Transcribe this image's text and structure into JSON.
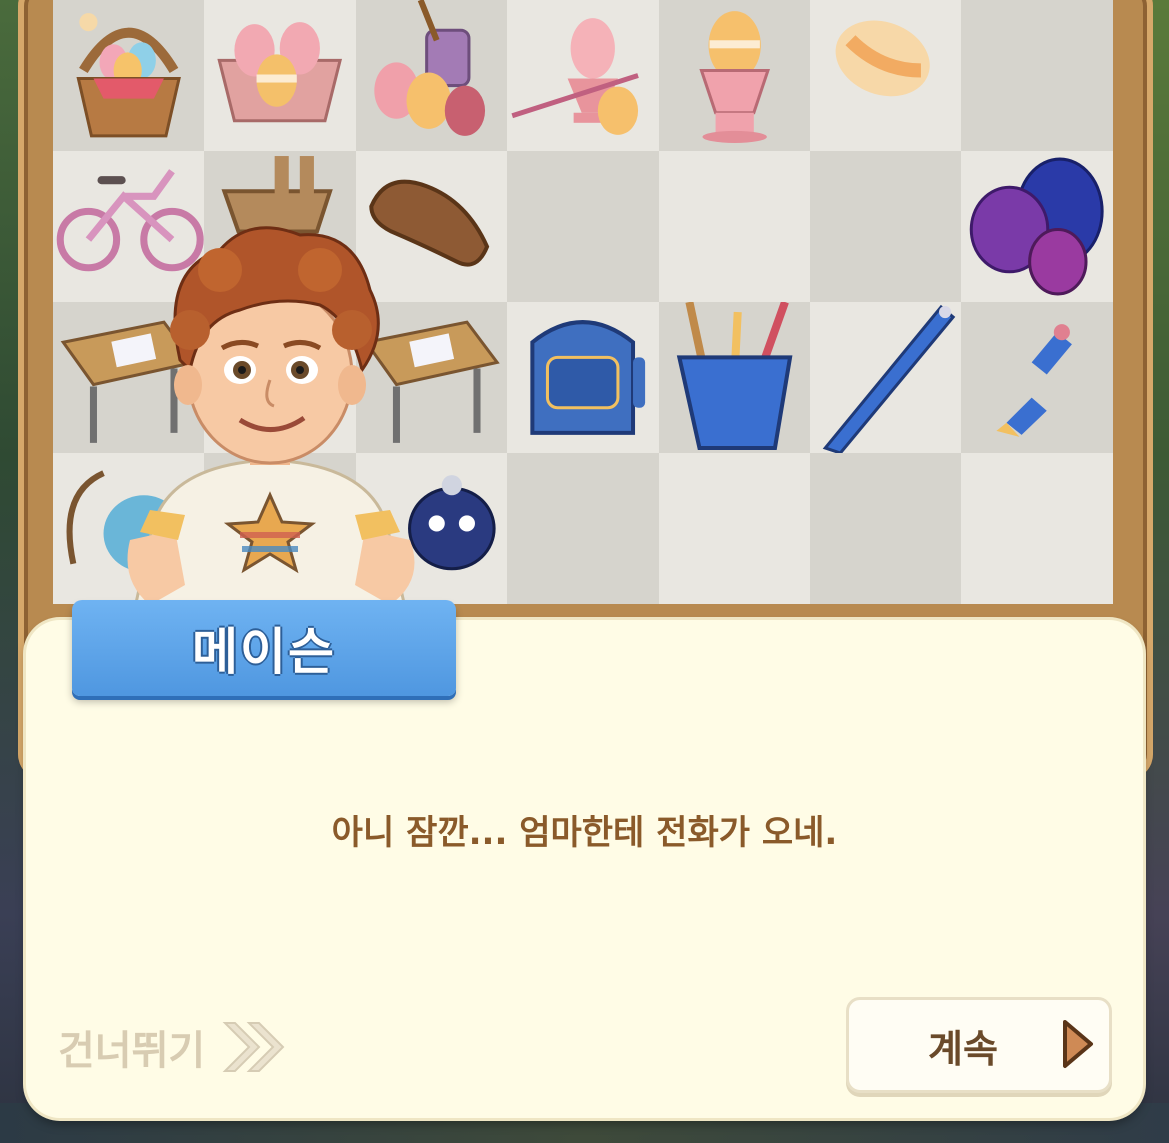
{
  "character": {
    "name": "메이슨"
  },
  "dialog": {
    "text": "아니 잠깐... 엄마한테 전화가 오네."
  },
  "controls": {
    "skip_label": "건너뛰기",
    "skip_icon": "double-chevron-right-icon",
    "continue_label": "계속",
    "continue_icon": "play-triangle-icon"
  },
  "board": {
    "rows": [
      [
        "easter-basket",
        "egg-carton",
        "paint-jar-eggs",
        "egg-cup-brush",
        "striped-egg-cup",
        "striped-egg",
        "empty"
      ],
      [
        "bicycle",
        "bike-basket",
        "bike-seat",
        "empty",
        "empty",
        "empty",
        "purple-blue-eggs"
      ],
      [
        "school-desk",
        "school-desk",
        "school-desk",
        "backpack",
        "pencil-cup",
        "ballpoint-pen",
        "broken-pencil"
      ],
      [
        "toy-bird-bow",
        "empty",
        "blue-bird-toy",
        "empty",
        "empty",
        "empty",
        "empty"
      ]
    ]
  },
  "colors": {
    "dialog_bg": "#fffce6",
    "name_tag": "#5aa3ea",
    "dialog_text": "#8a5a2a",
    "skip_text": "#d8ccb2",
    "continue_icon": "#cf8a55"
  }
}
